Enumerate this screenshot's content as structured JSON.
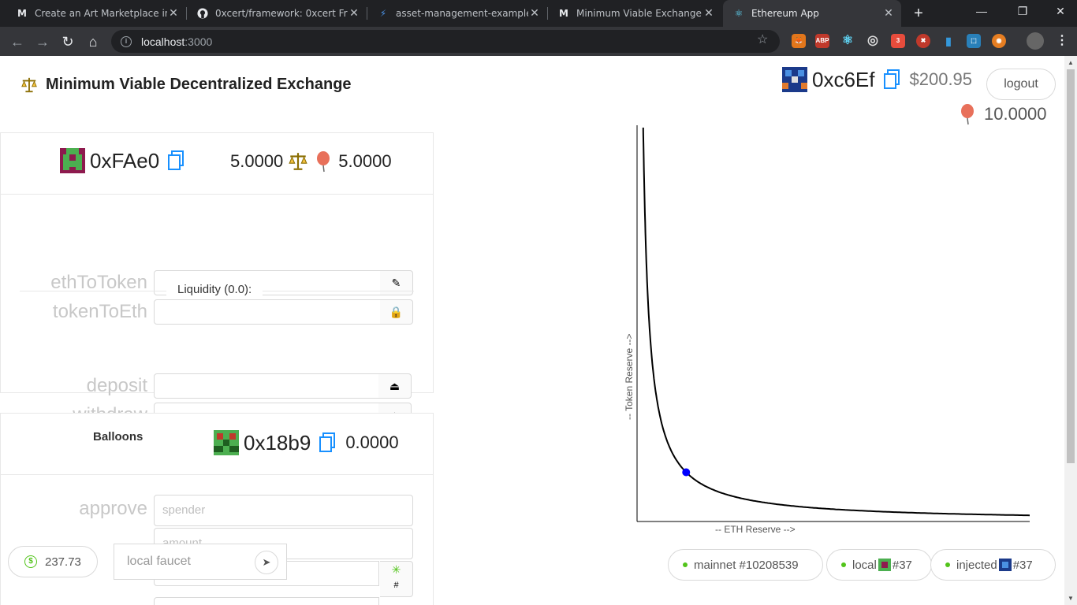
{
  "browser": {
    "tabs": [
      {
        "title": "Create an Art Marketplace in Et",
        "favicon": "M"
      },
      {
        "title": "0xcert/framework: 0xcert Fram",
        "favicon": "github"
      },
      {
        "title": "asset-management-example -",
        "favicon": "bolt"
      },
      {
        "title": "Minimum Viable Exchange",
        "favicon": "M"
      },
      {
        "title": "Ethereum App",
        "favicon": "react"
      }
    ],
    "url_host": "localhost",
    "url_port": ":3000",
    "ext_badge": "3",
    "ext_abp": "ABP"
  },
  "header": {
    "title": "Minimum Viable Decentralized Exchange",
    "account_address": "0xc6Ef",
    "account_balance": "$200.95",
    "logout_label": "logout",
    "balloon_balance": "10.0000"
  },
  "exchange_card": {
    "address": "0xFAe0",
    "eth_amount": "5.0000",
    "token_amount": "5.0000",
    "fields": [
      {
        "label": "ethToToken",
        "value": ""
      },
      {
        "label": "tokenToEth",
        "value": ""
      }
    ],
    "liquidity_label": "Liquidity (0.0):",
    "liquidity_fields": [
      {
        "label": "deposit",
        "value": ""
      },
      {
        "label": "withdraw",
        "value": ""
      }
    ]
  },
  "token_card": {
    "title": "Balloons",
    "address": "0x18b9",
    "balance": "0.0000",
    "approve_label": "approve",
    "spender_placeholder": "spender",
    "amount_placeholder": "amount"
  },
  "chart_data": {
    "type": "line",
    "xlabel": "-- ETH Reserve -->",
    "ylabel": "-- Token Reserve -->",
    "curve": "x*y=k",
    "point": {
      "x": 5,
      "y": 5
    },
    "colors": {
      "curve": "#000000",
      "point": "#0000ff"
    }
  },
  "networks": [
    {
      "label": "mainnet #10208539"
    },
    {
      "label": "local",
      "suffix": "#37"
    },
    {
      "label": "injected",
      "suffix": "#37"
    }
  ],
  "gas": {
    "value": "237.73"
  },
  "faucet": {
    "placeholder": "local faucet"
  }
}
